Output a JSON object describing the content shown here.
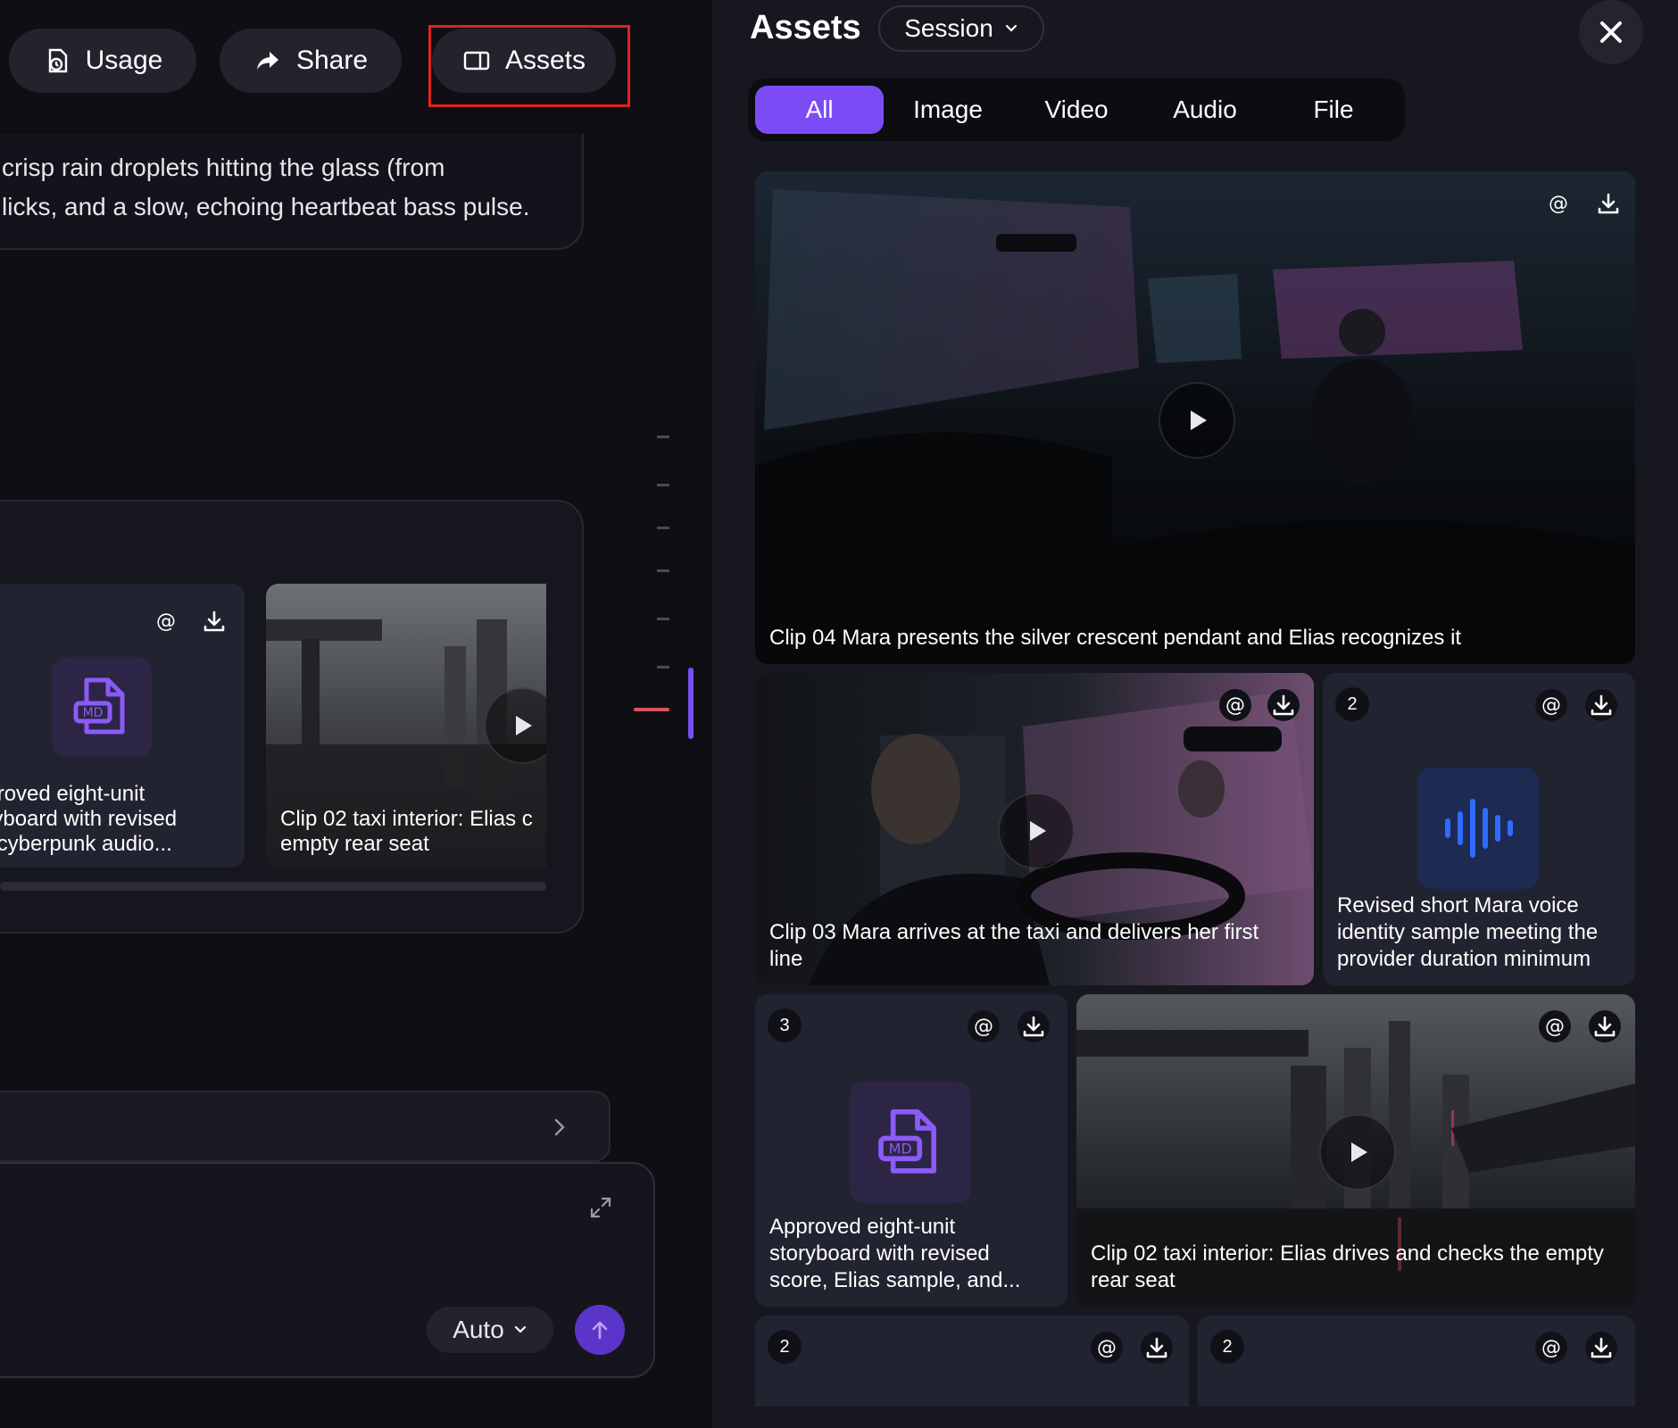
{
  "toolbar": {
    "usage_label": "Usage",
    "share_label": "Share",
    "assets_label": "Assets"
  },
  "chat": {
    "message_line_1": "crisp rain droplets hitting the glass (from",
    "message_line_2": "licks, and a slow, echoing heartbeat bass pulse.",
    "gallery": {
      "md_card_badge": "MD",
      "md_card_text_1": "pproved eight-unit",
      "md_card_text_2": "oryboard with revised",
      "md_card_text_3": "rk cyberpunk audio...",
      "clip_card_text_1": "Clip 02 taxi interior: Elias c",
      "clip_card_text_2": "empty rear seat"
    },
    "composer": {
      "mode_label": "Auto"
    }
  },
  "assets_panel": {
    "title": "Assets",
    "scope_label": "Session",
    "tabs": [
      {
        "label": "All",
        "active": true
      },
      {
        "label": "Image",
        "active": false
      },
      {
        "label": "Video",
        "active": false
      },
      {
        "label": "Audio",
        "active": false
      },
      {
        "label": "File",
        "active": false
      }
    ],
    "items": [
      {
        "type": "video",
        "caption": "Clip 04 Mara presents the silver crescent pendant and Elias recognizes it"
      },
      {
        "type": "video",
        "caption": "Clip 03 Mara arrives at the taxi and delivers her first line"
      },
      {
        "type": "audio",
        "count": "2",
        "caption": "Revised short Mara voice identity sample meeting the provider duration minimum"
      },
      {
        "type": "file",
        "count": "3",
        "badge": "MD",
        "caption": "Approved eight-unit storyboard with revised score, Elias sample, and..."
      },
      {
        "type": "video",
        "caption": "Clip 02 taxi interior: Elias drives and checks the empty rear seat"
      },
      {
        "type": "partial",
        "count": "2"
      },
      {
        "type": "partial",
        "count": "2"
      }
    ]
  },
  "colors": {
    "accent": "#7b4cf6",
    "highlight_box": "#e0241c",
    "audio_tile": "#1d2a52",
    "file_tile": "#2d2545"
  }
}
